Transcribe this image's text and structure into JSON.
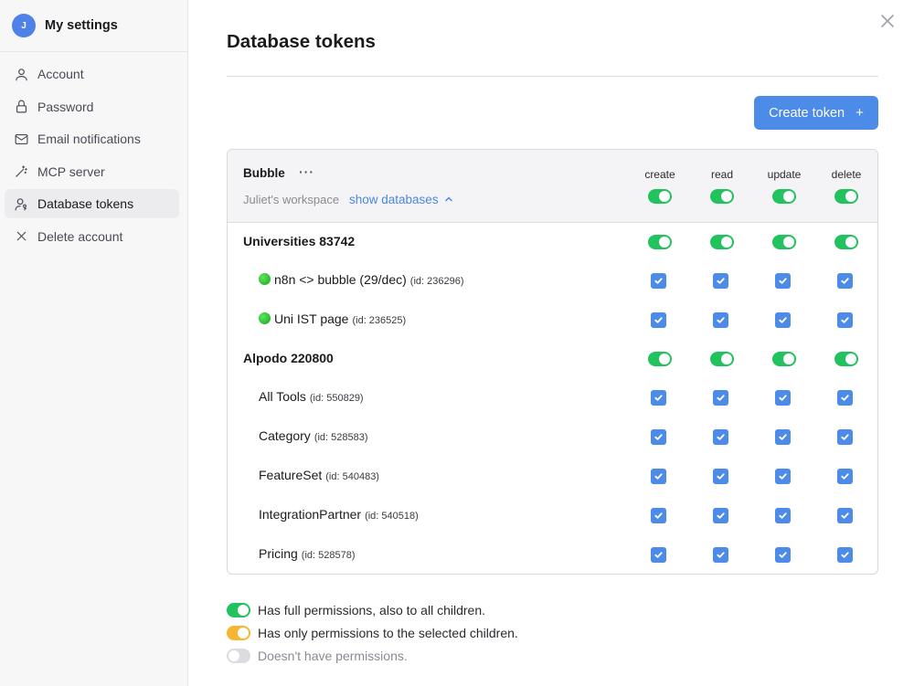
{
  "sidebar": {
    "avatar_initial": "J",
    "title": "My settings",
    "items": [
      {
        "label": "Account",
        "icon": "user-icon"
      },
      {
        "label": "Password",
        "icon": "lock-icon"
      },
      {
        "label": "Email notifications",
        "icon": "mail-icon"
      },
      {
        "label": "MCP server",
        "icon": "wand-icon"
      },
      {
        "label": "Database tokens",
        "icon": "user-key-icon",
        "active": true
      },
      {
        "label": "Delete account",
        "icon": "x-icon"
      }
    ]
  },
  "page": {
    "title": "Database tokens",
    "create_button_label": "Create token",
    "create_button_icon": "+"
  },
  "token": {
    "name": "Bubble",
    "menu": "···",
    "workspace": "Juliet's workspace",
    "show_databases_label": "show databases",
    "columns": [
      "create",
      "read",
      "update",
      "delete"
    ]
  },
  "rows": [
    {
      "type": "group",
      "label": "Universities 83742"
    },
    {
      "type": "table",
      "label": "n8n <> bubble (29/dec)",
      "id": "(id: 236296)",
      "status": "green-dot"
    },
    {
      "type": "table",
      "label": "Uni IST page",
      "id": "(id: 236525)",
      "status": "green-dot"
    },
    {
      "type": "group",
      "label": "Alpodo 220800"
    },
    {
      "type": "table",
      "label": "All Tools",
      "id": "(id: 550829)"
    },
    {
      "type": "table",
      "label": "Category",
      "id": "(id: 528583)"
    },
    {
      "type": "table",
      "label": "FeatureSet",
      "id": "(id: 540483)"
    },
    {
      "type": "table",
      "label": "IntegrationPartner",
      "id": "(id: 540518)"
    },
    {
      "type": "table",
      "label": "Pricing",
      "id": "(id: 528578)"
    }
  ],
  "legend": [
    {
      "text": "Has full permissions, also to all children.",
      "state": "full",
      "color": "#22c35e"
    },
    {
      "text": "Has only permissions to the selected children.",
      "state": "partial",
      "color": "#f5b731"
    },
    {
      "text": "Doesn't have permissions.",
      "state": "none",
      "color": "#dcdce0"
    }
  ],
  "colors": {
    "accent": "#4c8be8",
    "toggle_on": "#22c35e"
  }
}
